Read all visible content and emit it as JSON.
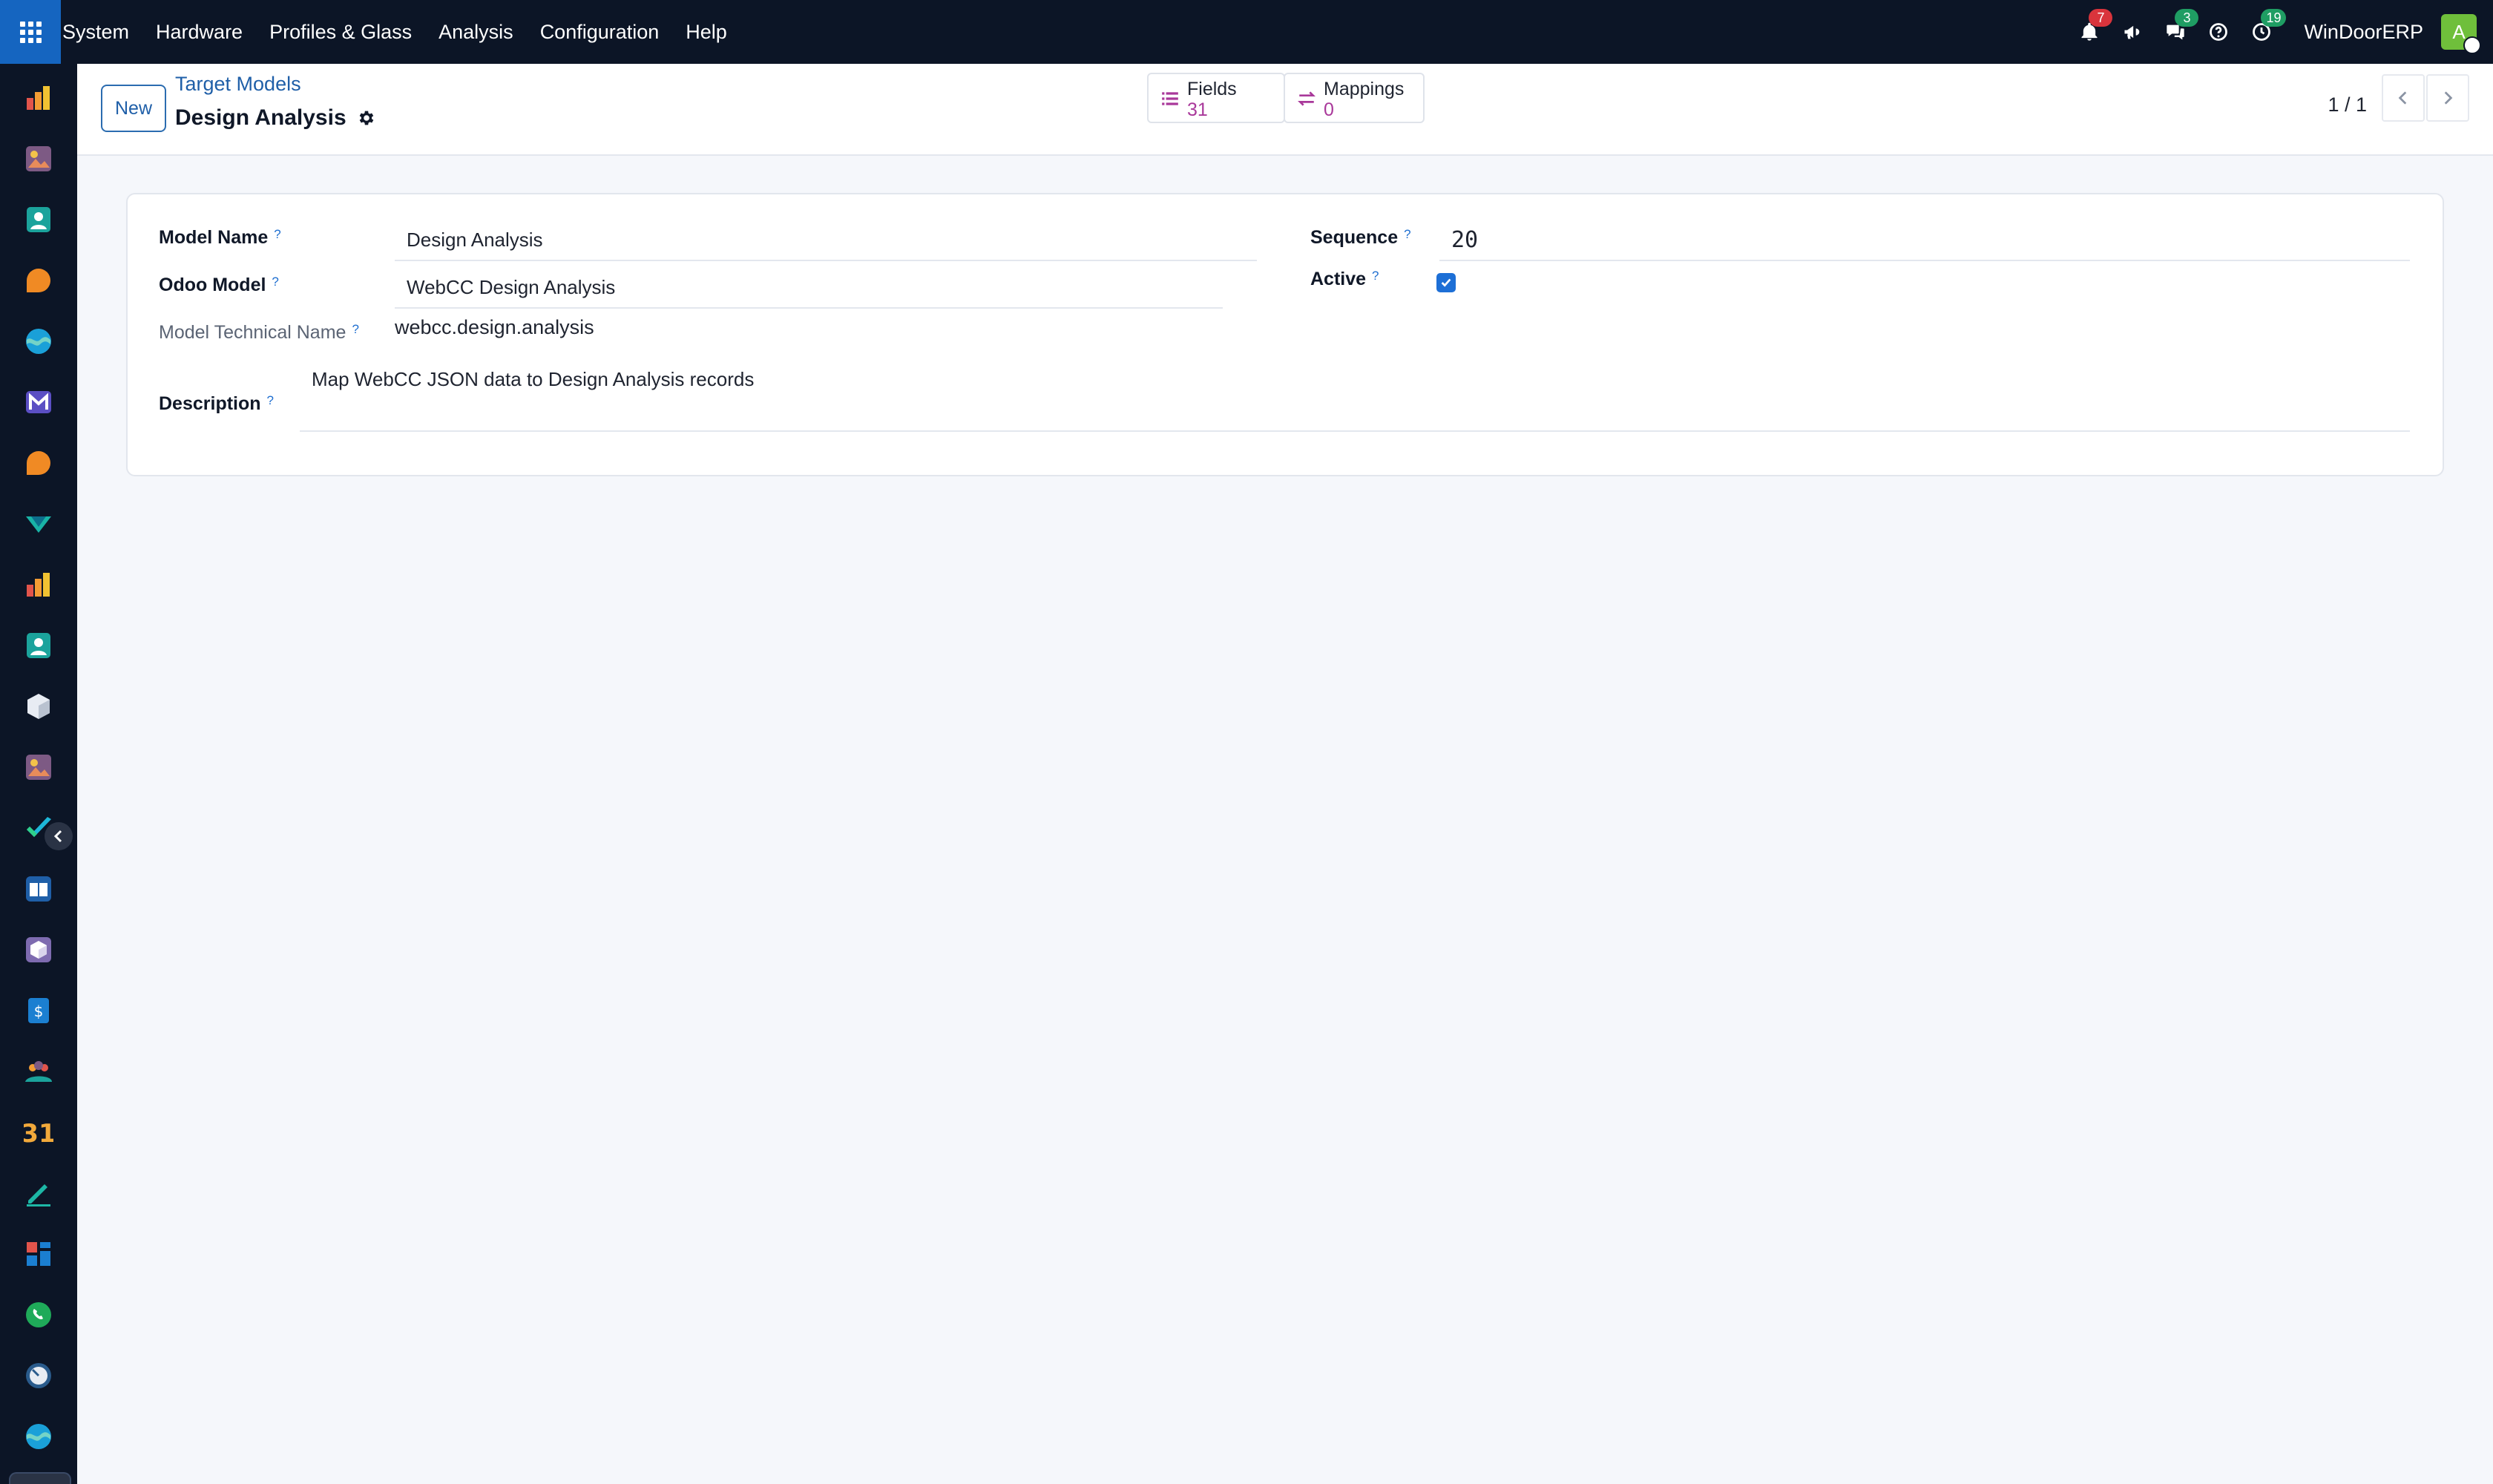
{
  "navbar": {
    "menu": [
      "System",
      "Hardware",
      "Profiles & Glass",
      "Analysis",
      "Configuration",
      "Help"
    ],
    "notifications_count": "7",
    "messages_count": "3",
    "activities_count": "19",
    "company": "WinDoorERP",
    "avatar_initial": "A"
  },
  "control_panel": {
    "new_label": "New",
    "breadcrumb": "Target Models",
    "record_title": "Design Analysis",
    "smart_buttons": [
      {
        "label": "Fields",
        "value": "31",
        "icon": "list-icon"
      },
      {
        "label": "Mappings",
        "value": "0",
        "icon": "exchange-icon"
      }
    ],
    "pager": "1 / 1"
  },
  "form": {
    "model_name": {
      "label": "Model Name",
      "help": "?",
      "value": "Design Analysis"
    },
    "odoo_model": {
      "label": "Odoo Model",
      "help": "?",
      "value": "WebCC Design Analysis"
    },
    "technical_name": {
      "label": "Model Technical Name",
      "help": "?",
      "value": "webcc.design.analysis"
    },
    "description": {
      "label": "Description",
      "help": "?",
      "value": "Map WebCC JSON data to Design Analysis records"
    },
    "sequence": {
      "label": "Sequence",
      "help": "?",
      "value": "20"
    },
    "active": {
      "label": "Active",
      "help": "?",
      "checked": true
    }
  },
  "colors": {
    "navbar_bg": "#0c1526",
    "brand_blue": "#1565c0",
    "link_blue": "#1f5fa8",
    "smart_value": "#a9389a",
    "badge_red": "#d9343c",
    "badge_green": "#1f9d63"
  },
  "sidebar_icons": [
    "bar-chart-icon",
    "image-app-icon",
    "contacts-icon",
    "chat-icon",
    "wave-icon",
    "gmail-icon",
    "chat-icon",
    "arrow-icon",
    "bar-chart-icon",
    "contacts-icon",
    "cube-icon",
    "image-app-icon",
    "check-icon",
    "book-icon",
    "package-icon",
    "invoice-icon",
    "team-icon",
    "calendar-31-icon",
    "pen-icon",
    "dashboard-icon",
    "whatsapp-icon",
    "clock-icon",
    "wave-icon"
  ]
}
